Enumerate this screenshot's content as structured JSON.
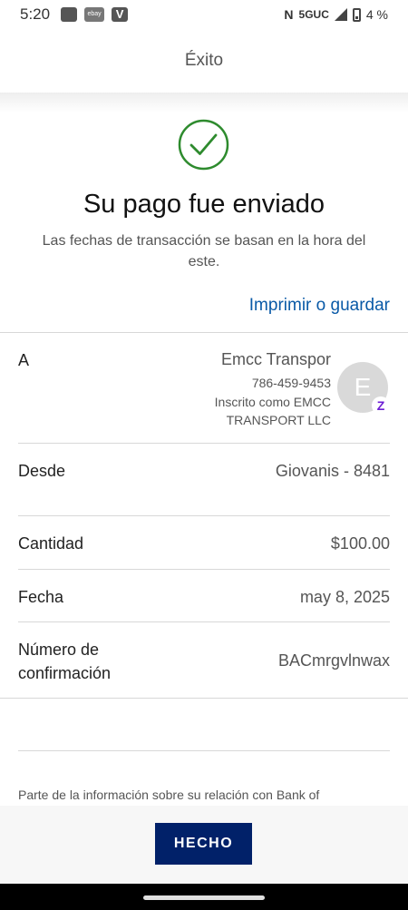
{
  "status_bar": {
    "time": "5:20",
    "icons": [
      "gallery-icon",
      "ebay-icon",
      "venmo-icon"
    ],
    "ebay_text": "ebay",
    "venmo_text": "V",
    "nfc_text": "N",
    "network": "5GUC",
    "battery": "4 %"
  },
  "header": {
    "title": "Éxito"
  },
  "success": {
    "title": "Su pago fue enviado",
    "subtitle": "Las fechas de transacción se basan en la hora del este.",
    "check_color": "#2e8b2e"
  },
  "print_link": "Imprimir o guardar",
  "rows": {
    "to": {
      "label": "A",
      "name": "Emcc Transpor",
      "phone": "786-459-9453",
      "enrolled": "Inscrito como EMCC TRANSPORT LLC",
      "avatar_initial": "E",
      "badge": "Z"
    },
    "from": {
      "label": "Desde",
      "value": "Giovanis - 8481"
    },
    "amount": {
      "label": "Cantidad",
      "value": "$100.00"
    },
    "date": {
      "label": "Fecha",
      "value": "may 8, 2025"
    },
    "confirmation": {
      "label": "Número de confirmación",
      "value": "BACmrgvlnwax"
    }
  },
  "footnote": "Parte de la información sobre su relación con Bank of",
  "done_button": "HECHO",
  "colors": {
    "link": "#0a5aa7",
    "button": "#012169",
    "badge": "#6d1ed4"
  }
}
